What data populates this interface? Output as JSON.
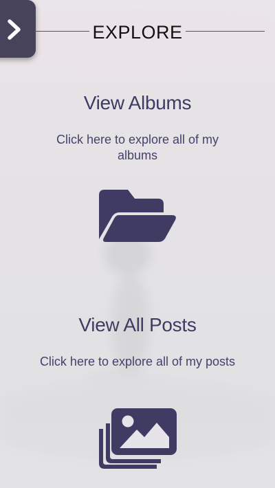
{
  "header": {
    "title": "EXPLORE"
  },
  "sidebar_toggle": {
    "icon": "chevron-right-icon"
  },
  "sections": {
    "albums": {
      "heading": "View Albums",
      "description": "Click here to explore all of my albums",
      "icon": "folder-open-icon"
    },
    "posts": {
      "heading": "View All Posts",
      "description": "Click here to explore all of my posts",
      "icon": "images-icon"
    }
  },
  "colors": {
    "accent": "#3f3b62",
    "toggle_bg": "#46435a",
    "background": "#e6e4e8",
    "title": "#111111"
  }
}
